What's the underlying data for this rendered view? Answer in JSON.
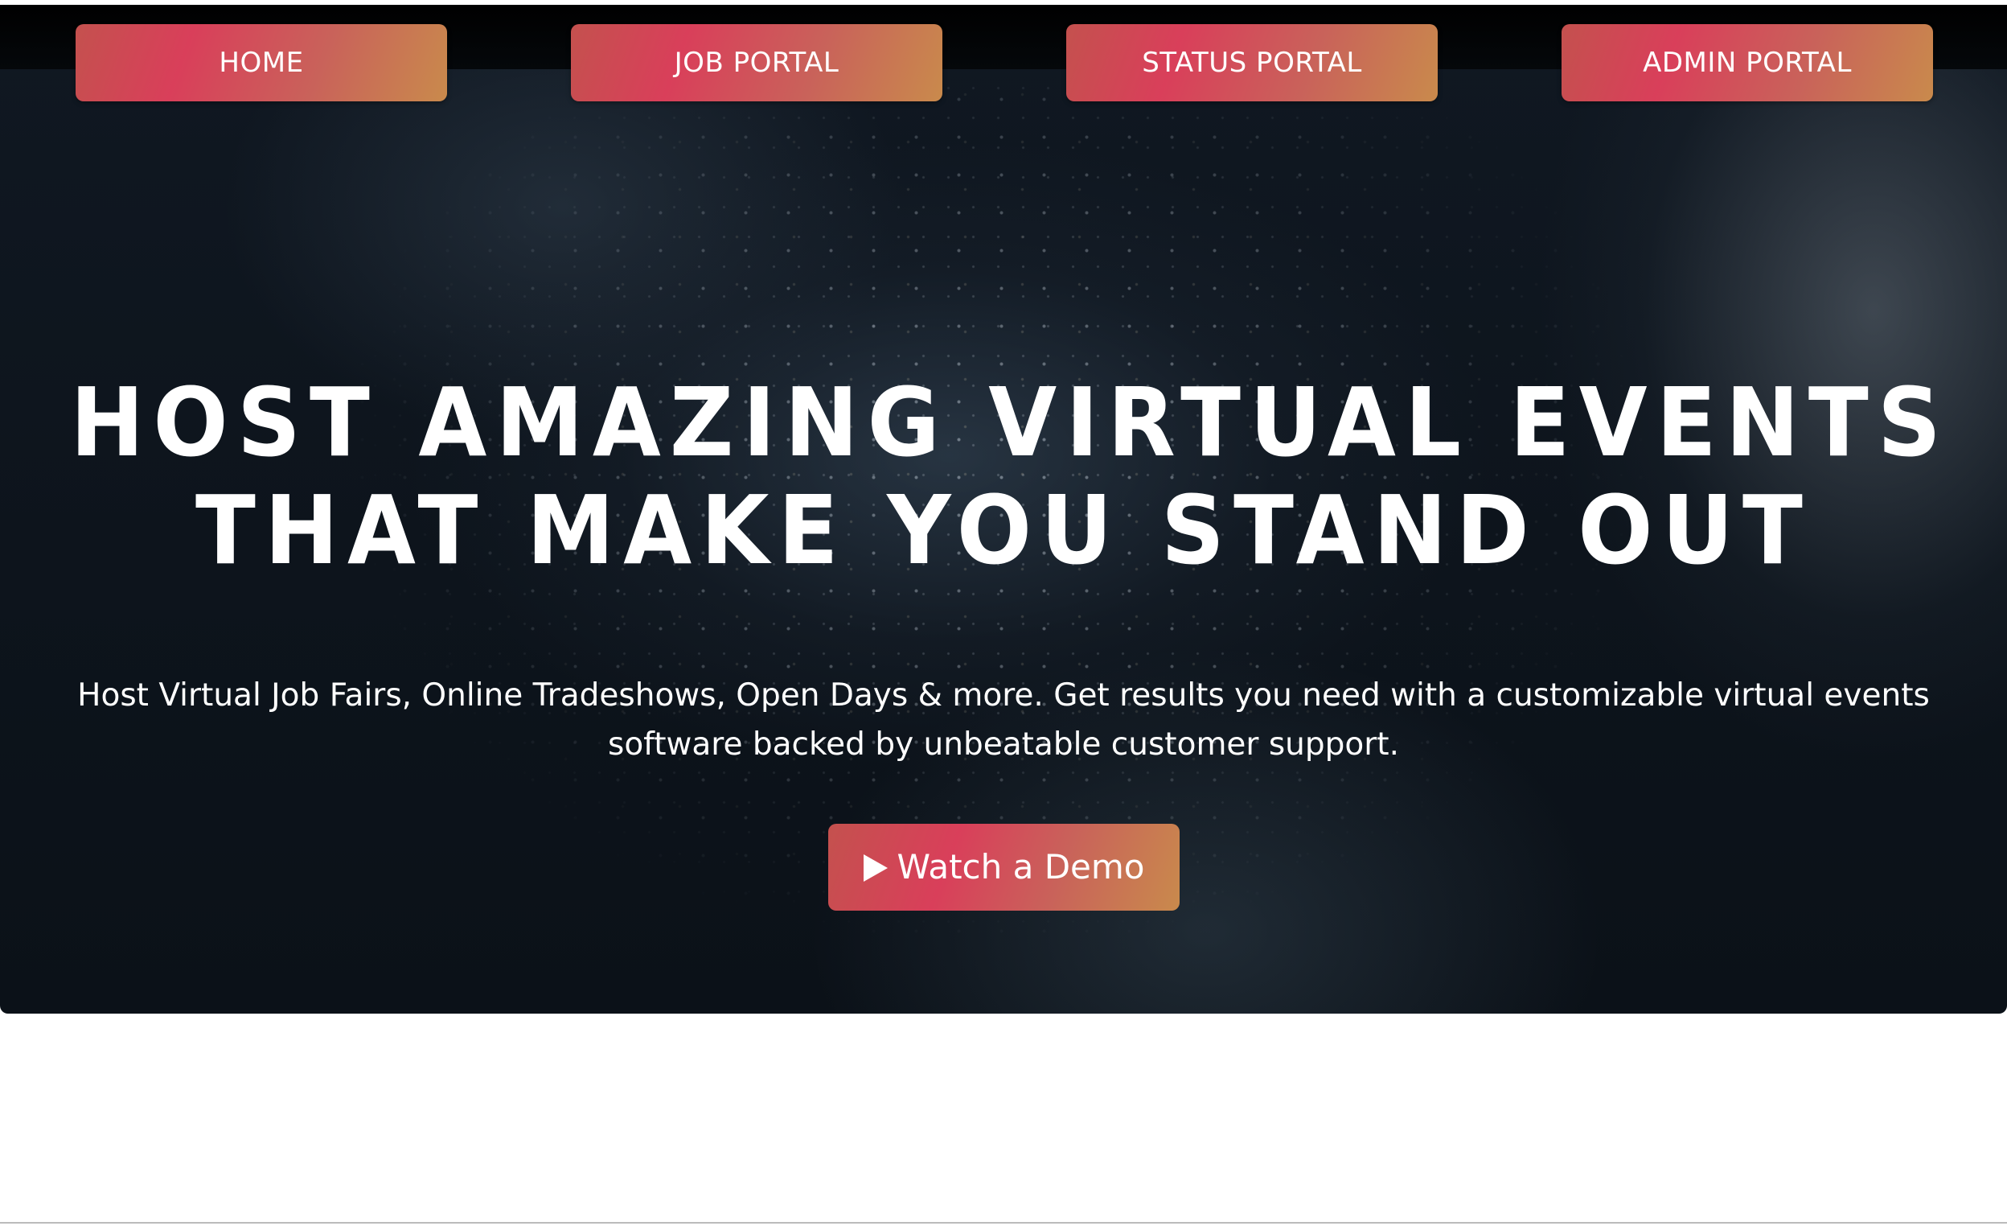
{
  "nav": {
    "items": [
      {
        "label": "HOME"
      },
      {
        "label": "JOB PORTAL"
      },
      {
        "label": "STATUS PORTAL"
      },
      {
        "label": "ADMIN PORTAL"
      }
    ]
  },
  "hero": {
    "headline_line1": "HOST AMAZING VIRTUAL EVENTS",
    "headline_line2": "THAT MAKE YOU STAND OUT",
    "subtitle": "Host Virtual Job Fairs, Online Tradeshows, Open Days & more. Get results you need with a customizable virtual events software backed by unbeatable customer support.",
    "cta_label": "Watch a Demo",
    "cta_icon": "play-icon"
  },
  "colors": {
    "button_gradient_start": "#c4514e",
    "button_gradient_mid": "#d93f5a",
    "button_gradient_end": "#c98a4c",
    "hero_background": "#0d141c",
    "text": "#ffffff"
  }
}
